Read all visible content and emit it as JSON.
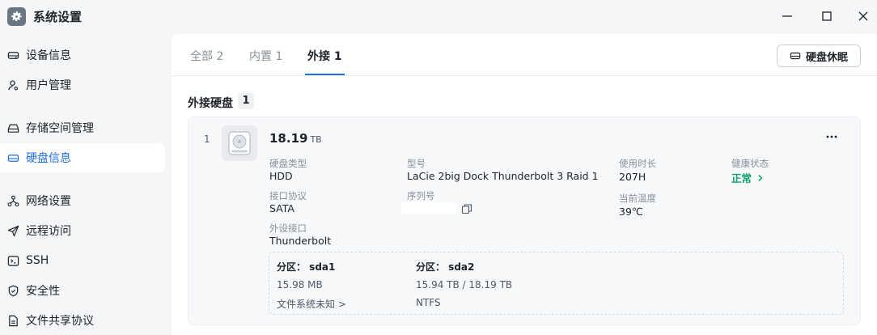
{
  "app": {
    "title": "系统设置"
  },
  "sidebar": {
    "items": [
      {
        "label": "设备信息",
        "icon": "drive-icon"
      },
      {
        "label": "用户管理",
        "icon": "user-icon"
      },
      {
        "label": "存储空间管理",
        "icon": "storage-icon"
      },
      {
        "label": "硬盘信息",
        "icon": "disk-icon",
        "active": true
      },
      {
        "label": "网络设置",
        "icon": "network-icon"
      },
      {
        "label": "远程访问",
        "icon": "send-icon"
      },
      {
        "label": "SSH",
        "icon": "ssh-icon"
      },
      {
        "label": "安全性",
        "icon": "shield-icon"
      },
      {
        "label": "文件共享协议",
        "icon": "file-icon"
      }
    ]
  },
  "tabs": [
    {
      "label": "全部 2"
    },
    {
      "label": "内置 1"
    },
    {
      "label": "外接 1",
      "active": true
    }
  ],
  "toolbar": {
    "sleep_label": "硬盘休眠"
  },
  "section": {
    "title": "外接硬盘",
    "count": "1"
  },
  "disk": {
    "index": "1",
    "capacity": "18.19",
    "capacity_unit": "TB",
    "type_label": "硬盘类型",
    "type_value": "HDD",
    "protocol_label": "接口协议",
    "protocol_value": "SATA",
    "ext_label": "外设接口",
    "ext_value": "Thunderbolt",
    "model_label": "型号",
    "model_value": "LaCie 2big Dock Thunderbolt 3 Raid 1",
    "serial_label": "序列号",
    "uptime_label": "使用时长",
    "uptime_value": "207H",
    "temp_label": "当前温度",
    "temp_value": "39℃",
    "health_label": "健康状态",
    "health_value": "正常",
    "health_color": "#12a06b"
  },
  "partitions": [
    {
      "head": "分区： sda1",
      "size": "15.98 MB",
      "fs": "文件系统未知 >"
    },
    {
      "head": "分区： sda2",
      "size": "15.94 TB / 18.19 TB",
      "fs": "NTFS"
    }
  ],
  "colors": {
    "accent": "#1f6fe0",
    "healthy": "#12a06b"
  }
}
